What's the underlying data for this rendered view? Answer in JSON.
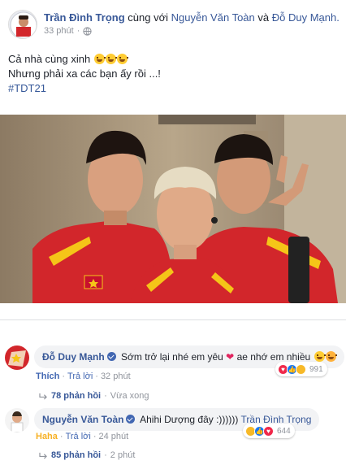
{
  "post": {
    "author": "Trần Đình Trọng",
    "with_text": "cùng với",
    "tagged_1": "Nguyễn Văn Toàn",
    "and_text": "và",
    "tagged_2": "Đỗ Duy Mạnh.",
    "time": "33 phút",
    "dot": "·",
    "privacy_icon": "globe-icon",
    "line1": "Cả nhà cùng xinh",
    "line2": "Nhưng phải xa các bạn ấy rồi ...!",
    "hashtag": "#TDT21"
  },
  "comments": [
    {
      "name": "Đỗ Duy Mạnh",
      "text_before": "Sớm trở lại nhé em yêu",
      "heart": "❤",
      "text_after": "ae nhớ em nhiều",
      "action": "Thích",
      "reply": "Trả lời",
      "time": "32 phút",
      "reaction_count": "991",
      "replies_count": "78 phản hồi",
      "replies_time": "Vừa xong",
      "replies_dot": "·"
    },
    {
      "name": "Nguyễn Văn Toàn",
      "text": "Ahihi Dượng đây :))))))",
      "tag": "Trần Đình Trọng",
      "action": "Haha",
      "reply": "Trả lời",
      "time": "24 phút",
      "reaction_count": "644",
      "replies_count": "85 phản hồi",
      "replies_time": "2 phút",
      "replies_dot": "·"
    }
  ],
  "ui": {
    "sep": "·"
  },
  "colors": {
    "link": "#385898",
    "muted": "#90949c",
    "bubble": "#f2f3f5",
    "jacket_red": "#d2262b",
    "jacket_yellow": "#f5c518"
  }
}
